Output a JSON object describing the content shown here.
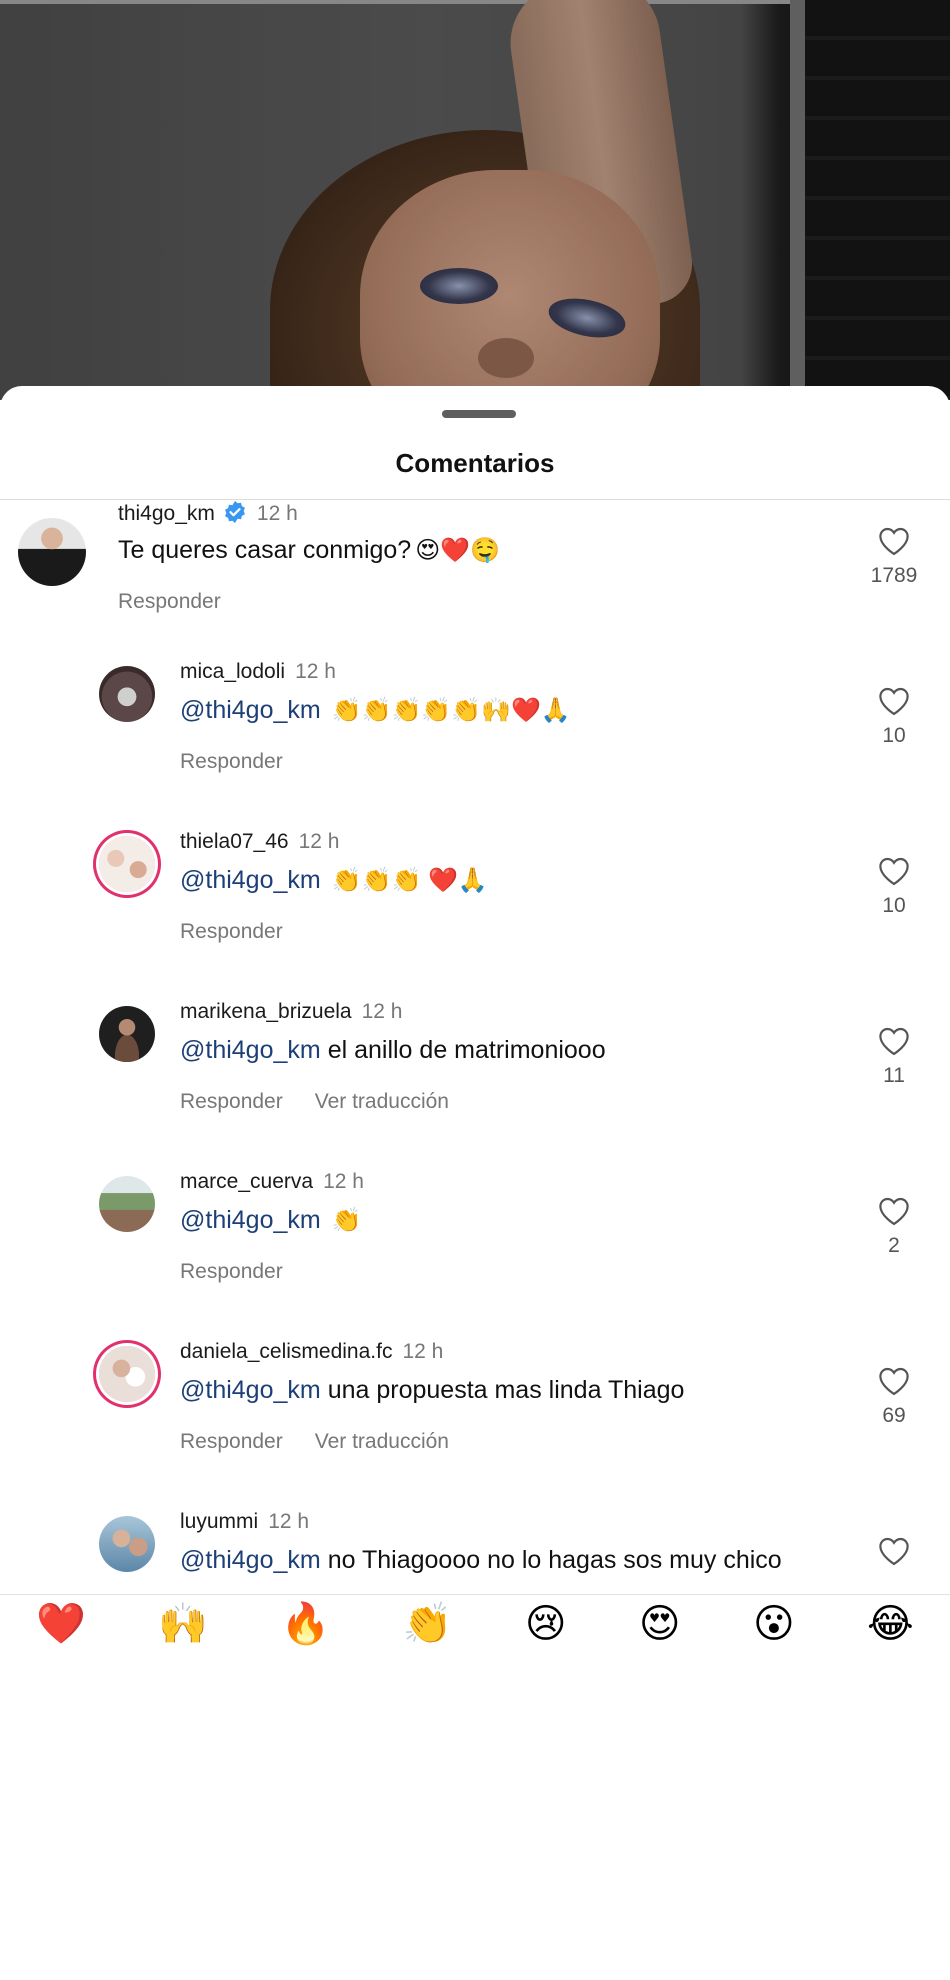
{
  "sheet": {
    "title": "Comentarios"
  },
  "comments": [
    {
      "user": "thi4go_km",
      "verified": true,
      "time": "12 h",
      "mention": "",
      "text": "Te queres casar conmigo?",
      "emoji": "😍❤️🤤",
      "actions": [
        "Responder"
      ],
      "likes": "1789"
    },
    {
      "user": "mica_lodoli",
      "verified": false,
      "time": "12 h",
      "mention": "@thi4go_km",
      "text": "",
      "emoji": "👏👏👏👏👏🙌❤️🙏",
      "actions": [
        "Responder"
      ],
      "likes": "10"
    },
    {
      "user": "thiela07_46",
      "verified": false,
      "time": "12 h",
      "mention": "@thi4go_km",
      "text": "",
      "emoji": "👏👏👏 ❤️🙏",
      "actions": [
        "Responder"
      ],
      "likes": "10"
    },
    {
      "user": "marikena_brizuela",
      "verified": false,
      "time": "12 h",
      "mention": "@thi4go_km",
      "text": "el anillo de matrimoniooo",
      "emoji": "",
      "actions": [
        "Responder",
        "Ver traducción"
      ],
      "likes": "11"
    },
    {
      "user": "marce_cuerva",
      "verified": false,
      "time": "12 h",
      "mention": "@thi4go_km",
      "text": "",
      "emoji": "👏",
      "actions": [
        "Responder"
      ],
      "likes": "2"
    },
    {
      "user": "daniela_celismedina.fc",
      "verified": false,
      "time": "12 h",
      "mention": "@thi4go_km",
      "text": "una propuesta mas linda Thiago",
      "emoji": "",
      "actions": [
        "Responder",
        "Ver traducción"
      ],
      "likes": "69"
    },
    {
      "user": "luyummi",
      "verified": false,
      "time": "12 h",
      "mention": "@thi4go_km",
      "text": "no Thiagoooo no lo hagas sos muy chico",
      "emoji": "",
      "actions": [],
      "likes": ""
    }
  ],
  "reactions": [
    "❤️",
    "🙌",
    "🔥",
    "👏",
    "😢",
    "😍",
    "😮",
    "😂"
  ],
  "colors": {
    "mention": "#1d3f78",
    "story_ring": "#e1306c",
    "verified": "#3897f0"
  }
}
